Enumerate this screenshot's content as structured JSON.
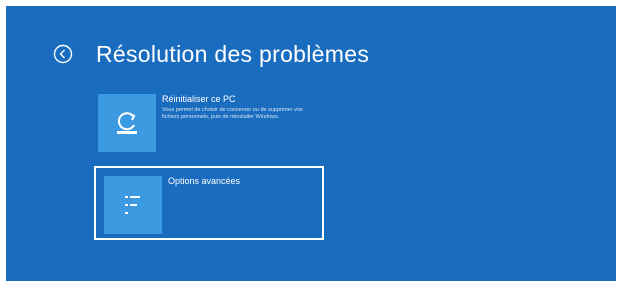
{
  "header": {
    "title": "Résolution des problèmes",
    "back_icon": "back-arrow-circle-icon"
  },
  "tiles": [
    {
      "title": "Réinitialiser ce PC",
      "description": "Vous permet de choisir de conserver ou de supprimer vos fichiers personnels, puis de réinstaller Windows.",
      "icon": "reset-pc-icon"
    },
    {
      "title": "Options avancées",
      "icon": "checklist-icon"
    }
  ],
  "colors": {
    "background": "#1a6cbf",
    "tile_icon_bg": "#3c9be0",
    "text": "#ffffff"
  }
}
